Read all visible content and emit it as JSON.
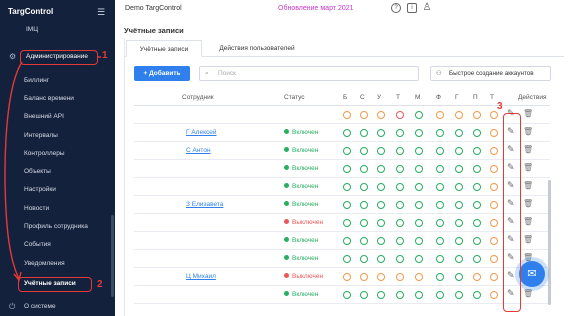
{
  "sidebar": {
    "brand": "TargControl",
    "items": [
      {
        "label": "ІМЦ"
      },
      {
        "label": "Администрирование"
      },
      {
        "label": "Биллинг"
      },
      {
        "label": "Баланс времени"
      },
      {
        "label": "Внешний API"
      },
      {
        "label": "Интервалы"
      },
      {
        "label": "Контроллеры"
      },
      {
        "label": "Объекты"
      },
      {
        "label": "Настройки"
      },
      {
        "label": "Новости"
      },
      {
        "label": "Профиль сотрудника"
      },
      {
        "label": "События"
      },
      {
        "label": "Уведомления"
      },
      {
        "label": "Учётные записи"
      }
    ],
    "logout": "О системе"
  },
  "topbar": {
    "org": "Demo TargControl",
    "update": "Обновление март 2021"
  },
  "page": {
    "title": "Учётные записи",
    "tabs": [
      "Учётные записи",
      "Действия пользователей"
    ]
  },
  "toolbar": {
    "add": "Добавить",
    "search_placeholder": "Поиск",
    "quick": "Быстрое создание аккаунтов"
  },
  "table": {
    "headers": {
      "employee": "Сотрудник",
      "status": "Статус",
      "actions": "Действия"
    },
    "days": [
      "Б",
      "С",
      "У",
      "Т",
      "М",
      "Ф",
      "Г",
      "П",
      "Т"
    ],
    "rows": [
      {
        "name": "",
        "status": "",
        "circles": [
          "o",
          "o",
          "o",
          "r",
          "g",
          "o",
          "o",
          "o",
          "o"
        ]
      },
      {
        "name": "Г Алексей",
        "status": "Включен",
        "circles": [
          "g",
          "g",
          "g",
          "g",
          "g",
          "g",
          "g",
          "g",
          "o"
        ]
      },
      {
        "name": "С Антон",
        "status": "Включен",
        "circles": [
          "g",
          "g",
          "g",
          "g",
          "g",
          "g",
          "g",
          "g",
          "o"
        ]
      },
      {
        "name": "",
        "status": "Включен",
        "circles": [
          "g",
          "g",
          "g",
          "g",
          "g",
          "g",
          "g",
          "g",
          "o"
        ]
      },
      {
        "name": "",
        "status": "Включен",
        "circles": [
          "g",
          "g",
          "g",
          "g",
          "g",
          "g",
          "g",
          "g",
          "o"
        ]
      },
      {
        "name": "З Елизавета",
        "status": "Включен",
        "circles": [
          "g",
          "g",
          "g",
          "g",
          "g",
          "g",
          "g",
          "g",
          "o"
        ]
      },
      {
        "name": "",
        "status": "Выключен",
        "circles": [
          "g",
          "g",
          "g",
          "g",
          "g",
          "g",
          "g",
          "g",
          "o"
        ]
      },
      {
        "name": "",
        "status": "Включен",
        "circles": [
          "g",
          "g",
          "g",
          "g",
          "g",
          "g",
          "g",
          "g",
          "o"
        ]
      },
      {
        "name": "",
        "status": "Включен",
        "circles": [
          "g",
          "g",
          "g",
          "g",
          "g",
          "g",
          "g",
          "g",
          "o"
        ]
      },
      {
        "name": "Ц Михаил",
        "status": "Выключен",
        "circles": [
          "o",
          "o",
          "o",
          "o",
          "o",
          "g",
          "g",
          "o",
          "o"
        ]
      },
      {
        "name": "",
        "status": "Включен",
        "circles": [
          "g",
          "g",
          "g",
          "g",
          "g",
          "g",
          "g",
          "g",
          "o"
        ]
      }
    ]
  },
  "annotations": [
    "1",
    "2",
    "3"
  ],
  "colors": {
    "sidebar_bg": "#14213d",
    "accent": "#2f80ed",
    "annotation": "#e53935",
    "enabled": "#27ae60",
    "disabled": "#eb5757",
    "circle_orange": "#f2994a",
    "circle_red": "#eb5757",
    "circle_green": "#27ae60",
    "update_text": "#c838c8"
  },
  "icons": {
    "menu": "hamburger-icon",
    "settings": "gear-icon",
    "edit": "pencil-icon",
    "delete": "trash-icon",
    "chat": "chat-icon"
  }
}
